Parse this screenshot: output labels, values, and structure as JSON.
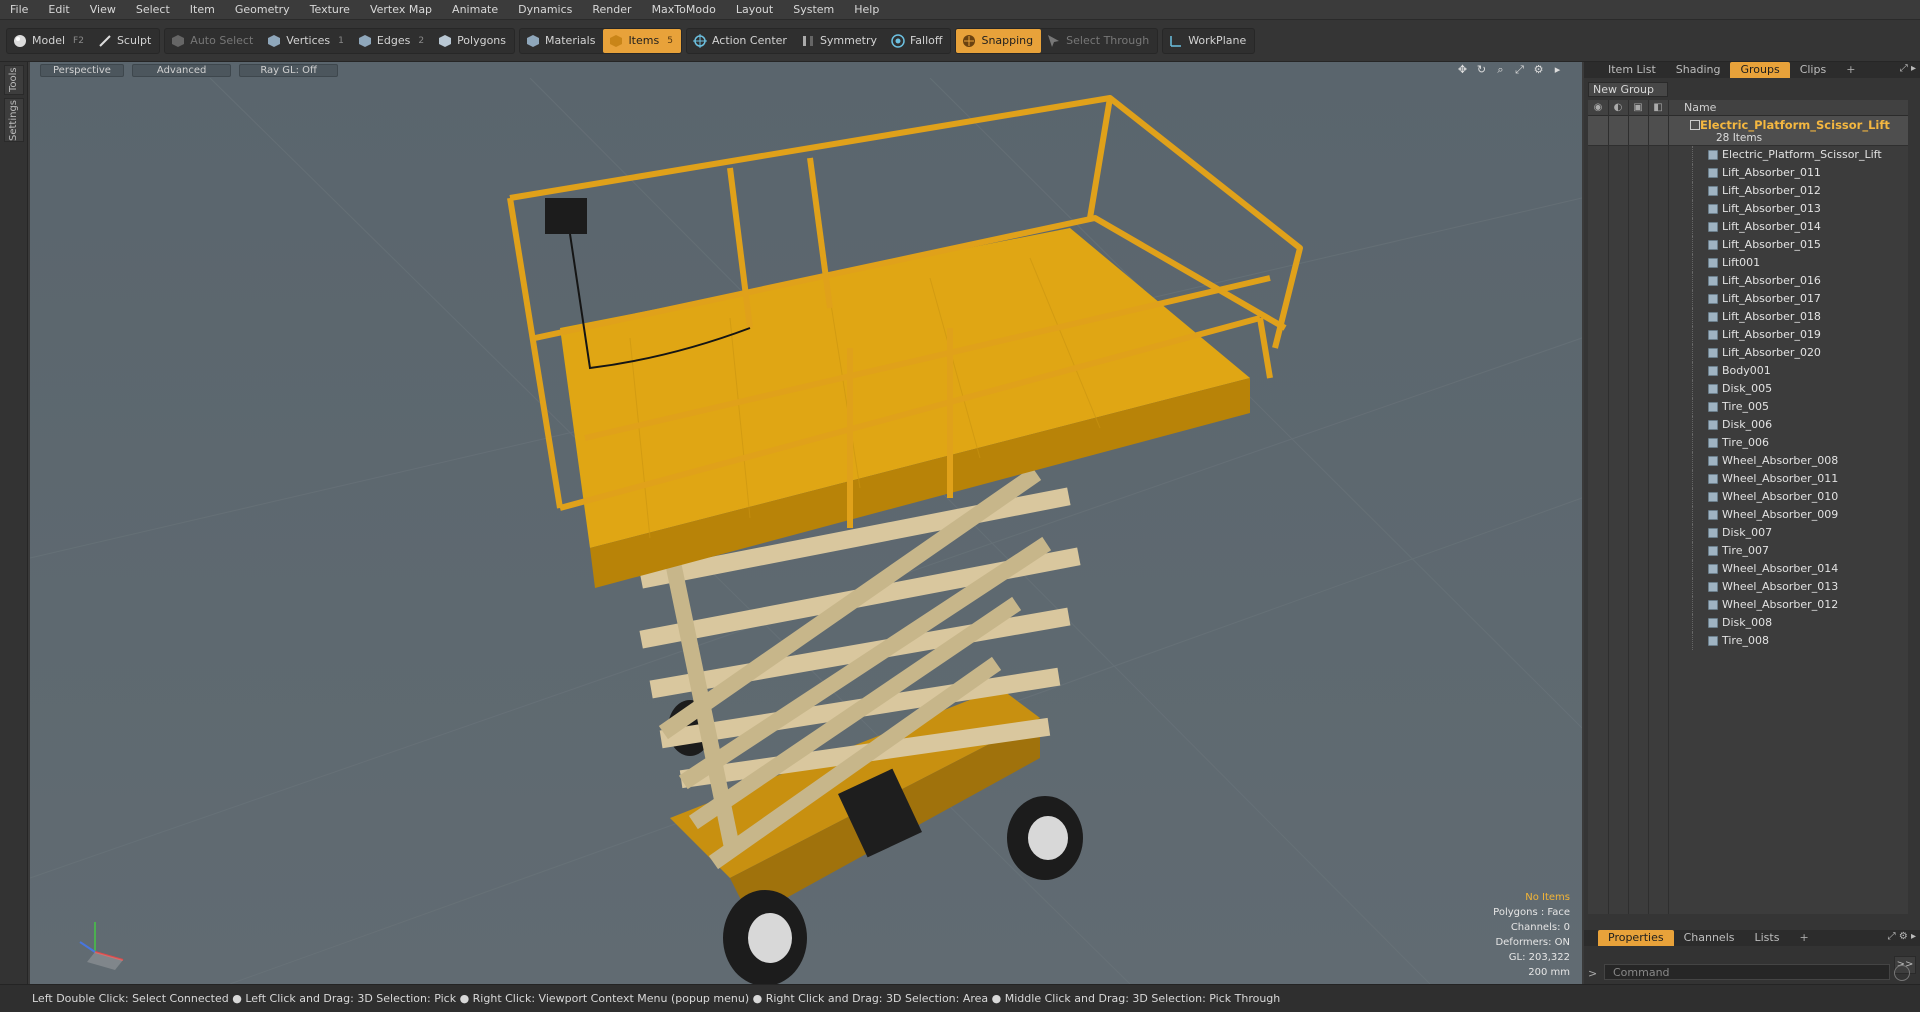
{
  "menu": [
    "File",
    "Edit",
    "View",
    "Select",
    "Item",
    "Geometry",
    "Texture",
    "Vertex Map",
    "Animate",
    "Dynamics",
    "Render",
    "MaxToModo",
    "Layout",
    "System",
    "Help"
  ],
  "toolbar": {
    "model": "Model",
    "model_key": "F2",
    "sculpt": "Sculpt",
    "auto_select": "Auto Select",
    "vertices": "Vertices",
    "vertices_key": "1",
    "edges": "Edges",
    "edges_key": "2",
    "polygons": "Polygons",
    "materials": "Materials",
    "items": "Items",
    "items_key": "5",
    "action_center": "Action Center",
    "symmetry": "Symmetry",
    "falloff": "Falloff",
    "snapping": "Snapping",
    "select_through": "Select Through",
    "workplane": "WorkPlane",
    "accent": "#e8a23a"
  },
  "side_tabs": [
    "Tools",
    "Settings"
  ],
  "viewport": {
    "tabs": [
      "Perspective",
      "Advanced",
      "Ray GL: Off"
    ],
    "info": {
      "no_items": "No Items",
      "polygons": "Polygons : Face",
      "channels": "Channels: 0",
      "deformers": "Deformers: ON",
      "gl": "GL: 203,322",
      "scale": "200 mm"
    }
  },
  "status": "Left Double Click: Select Connected ● Left Click and Drag: 3D Selection: Pick ● Right Click: Viewport Context Menu (popup menu) ● Right Click and Drag: 3D Selection: Area ● Middle Click and Drag: 3D Selection: Pick Through",
  "panel": {
    "tabs": [
      "Item List",
      "Shading",
      "Groups",
      "Clips"
    ],
    "active_tab": "Groups",
    "new_group": "New Group",
    "name_header": "Name",
    "group_name": "Electric_Platform_Scissor_Lift",
    "group_count": "28 Items",
    "items": [
      "Electric_Platform_Scissor_Lift",
      "Lift_Absorber_011",
      "Lift_Absorber_012",
      "Lift_Absorber_013",
      "Lift_Absorber_014",
      "Lift_Absorber_015",
      "Lift001",
      "Lift_Absorber_016",
      "Lift_Absorber_017",
      "Lift_Absorber_018",
      "Lift_Absorber_019",
      "Lift_Absorber_020",
      "Body001",
      "Disk_005",
      "Tire_005",
      "Disk_006",
      "Tire_006",
      "Wheel_Absorber_008",
      "Wheel_Absorber_011",
      "Wheel_Absorber_010",
      "Wheel_Absorber_009",
      "Disk_007",
      "Tire_007",
      "Wheel_Absorber_014",
      "Wheel_Absorber_013",
      "Wheel_Absorber_012",
      "Disk_008",
      "Tire_008"
    ],
    "bottom_tabs": [
      "Properties",
      "Channels",
      "Lists"
    ],
    "command_placeholder": "Command"
  }
}
